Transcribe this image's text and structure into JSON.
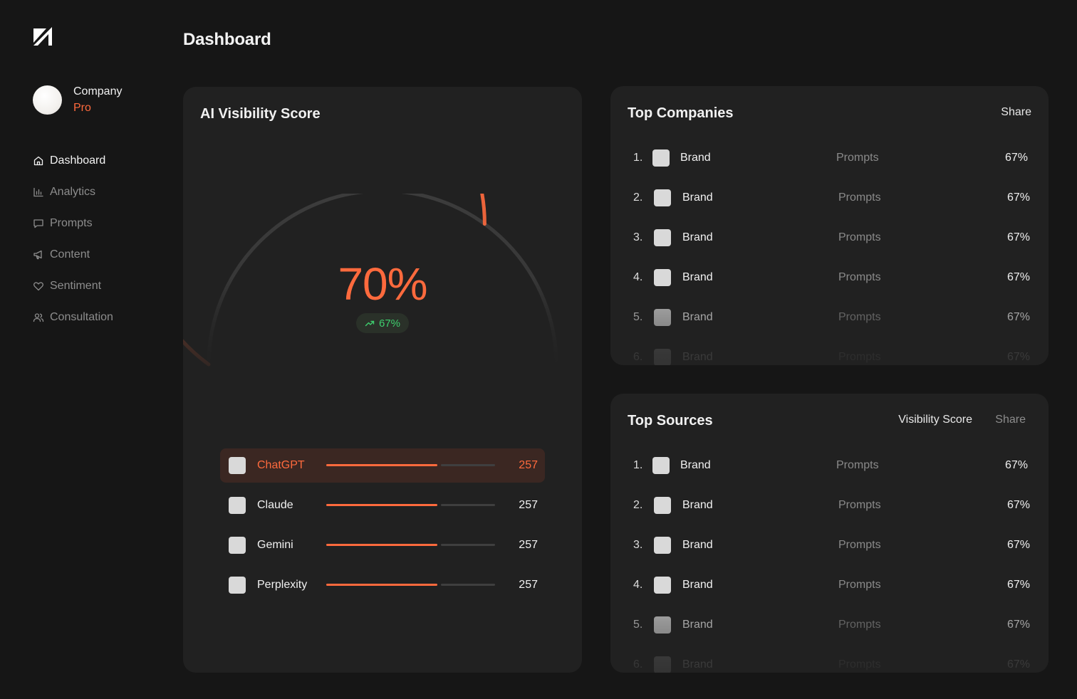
{
  "sidebar": {
    "company_name": "Company",
    "plan": "Pro",
    "items": [
      {
        "label": "Dashboard",
        "icon": "home-icon",
        "active": true
      },
      {
        "label": "Analytics",
        "icon": "bar-chart-icon",
        "active": false
      },
      {
        "label": "Prompts",
        "icon": "message-icon",
        "active": false
      },
      {
        "label": "Content",
        "icon": "megaphone-icon",
        "active": false
      },
      {
        "label": "Sentiment",
        "icon": "heart-icon",
        "active": false
      },
      {
        "label": "Consultation",
        "icon": "users-icon",
        "active": false
      }
    ]
  },
  "header": {
    "title": "Dashboard"
  },
  "score_card": {
    "title": "AI Visibility Score",
    "score": "70%",
    "score_fraction": 0.7,
    "trend": "67%",
    "models": [
      {
        "name": "ChatGPT",
        "value": "257",
        "fraction": 0.66,
        "highlight": true
      },
      {
        "name": "Claude",
        "value": "257",
        "fraction": 0.66,
        "highlight": false
      },
      {
        "name": "Gemini",
        "value": "257",
        "fraction": 0.66,
        "highlight": false
      },
      {
        "name": "Perplexity",
        "value": "257",
        "fraction": 0.66,
        "highlight": false
      }
    ]
  },
  "companies_card": {
    "title": "Top Companies",
    "share_header": "Share",
    "rows": [
      {
        "rank": "1.",
        "name": "Brand",
        "prompts": "Prompts",
        "share": "67%"
      },
      {
        "rank": "2.",
        "name": "Brand",
        "prompts": "Prompts",
        "share": "67%"
      },
      {
        "rank": "3.",
        "name": "Brand",
        "prompts": "Prompts",
        "share": "67%"
      },
      {
        "rank": "4.",
        "name": "Brand",
        "prompts": "Prompts",
        "share": "67%"
      },
      {
        "rank": "5.",
        "name": "Brand",
        "prompts": "Prompts",
        "share": "67%"
      },
      {
        "rank": "6.",
        "name": "Brand",
        "prompts": "Prompts",
        "share": "67%"
      }
    ]
  },
  "sources_card": {
    "title": "Top Sources",
    "visibility_header": "Visibility Score",
    "share_header": "Share",
    "rows": [
      {
        "rank": "1.",
        "name": "Brand",
        "prompts": "Prompts",
        "share": "67%"
      },
      {
        "rank": "2.",
        "name": "Brand",
        "prompts": "Prompts",
        "share": "67%"
      },
      {
        "rank": "3.",
        "name": "Brand",
        "prompts": "Prompts",
        "share": "67%"
      },
      {
        "rank": "4.",
        "name": "Brand",
        "prompts": "Prompts",
        "share": "67%"
      },
      {
        "rank": "5.",
        "name": "Brand",
        "prompts": "Prompts",
        "share": "67%"
      },
      {
        "rank": "6.",
        "name": "Brand",
        "prompts": "Prompts",
        "share": "67%"
      }
    ]
  },
  "colors": {
    "accent": "#ff6a3d",
    "positive": "#3ecf6e",
    "background": "#161616",
    "card": "#212121"
  }
}
